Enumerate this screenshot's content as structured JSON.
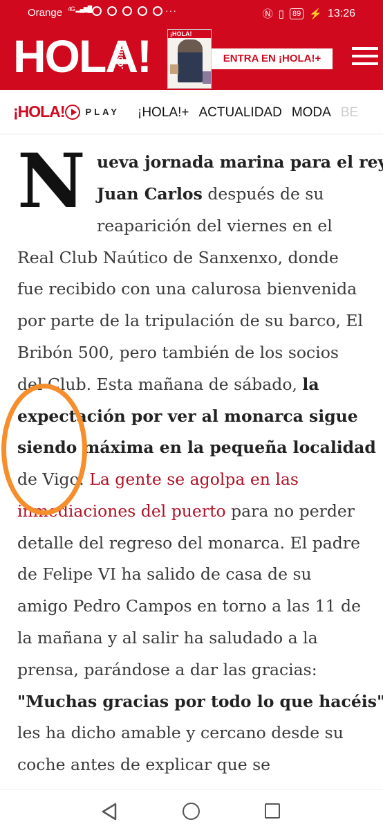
{
  "status_bar": {
    "carrier": "Orange",
    "network": "4G",
    "more_indicator": "···",
    "battery": "89",
    "time": "13:26"
  },
  "header": {
    "logo": "HOLA!",
    "logo_suffix": ".com",
    "magazine_cover_label": "¡HOLA!",
    "cta_label": "ENTRA EN ¡HOLA!+",
    "menu_icon": "hamburger-menu-icon"
  },
  "nav": {
    "brand_logo": "¡HOLA!",
    "brand_play": "PLAY",
    "links": [
      "¡HOLA!+",
      "ACTUALIDAD",
      "MODA",
      "BE"
    ]
  },
  "article": {
    "drop_cap": "N",
    "lines": {
      "l1_bold": "ueva jornada marina para el rey",
      "l2_bold": "Juan Carlos",
      "l2_rest": " después de su",
      "l3": "reaparición del viernes en el",
      "l4": "Real Club Naútico de Sanxenxo, donde",
      "l5": "fue recibido con una calurosa bienvenida",
      "l6": "por parte de la tripulación de su barco, El",
      "l7": "Bribón 500, pero también de los socios",
      "l8_normal": "del Club. Esta mañana de sábado, ",
      "l8_bold": "la",
      "l9_bold": "expectación por ver al monarca sigue",
      "l10_bold": "siendo máxima en la pequeña localidad",
      "l11_normal": "de Vigo. ",
      "l11_red": "La gente se agolpa en las",
      "l12_red": "inmediaciones del puerto",
      "l12_rest": " para no perder",
      "l13": "detalle del regreso del monarca. El padre",
      "l14": "de Felipe VI ha salido de casa de su",
      "l15": "amigo Pedro Campos en torno a las 11 de",
      "l16": "la mañana y al salir ha saludado a la",
      "l17": "prensa, parándose a dar las gracias:",
      "l18_bold": "\"Muchas gracias por todo lo que hacéis\",",
      "l19": "les ha dicho amable y cercano desde su",
      "l20": "coche antes de explicar que se"
    }
  },
  "colors": {
    "brand_red": "#d0091e",
    "link_red": "#b01226",
    "highlight_orange": "#f58e2b"
  }
}
